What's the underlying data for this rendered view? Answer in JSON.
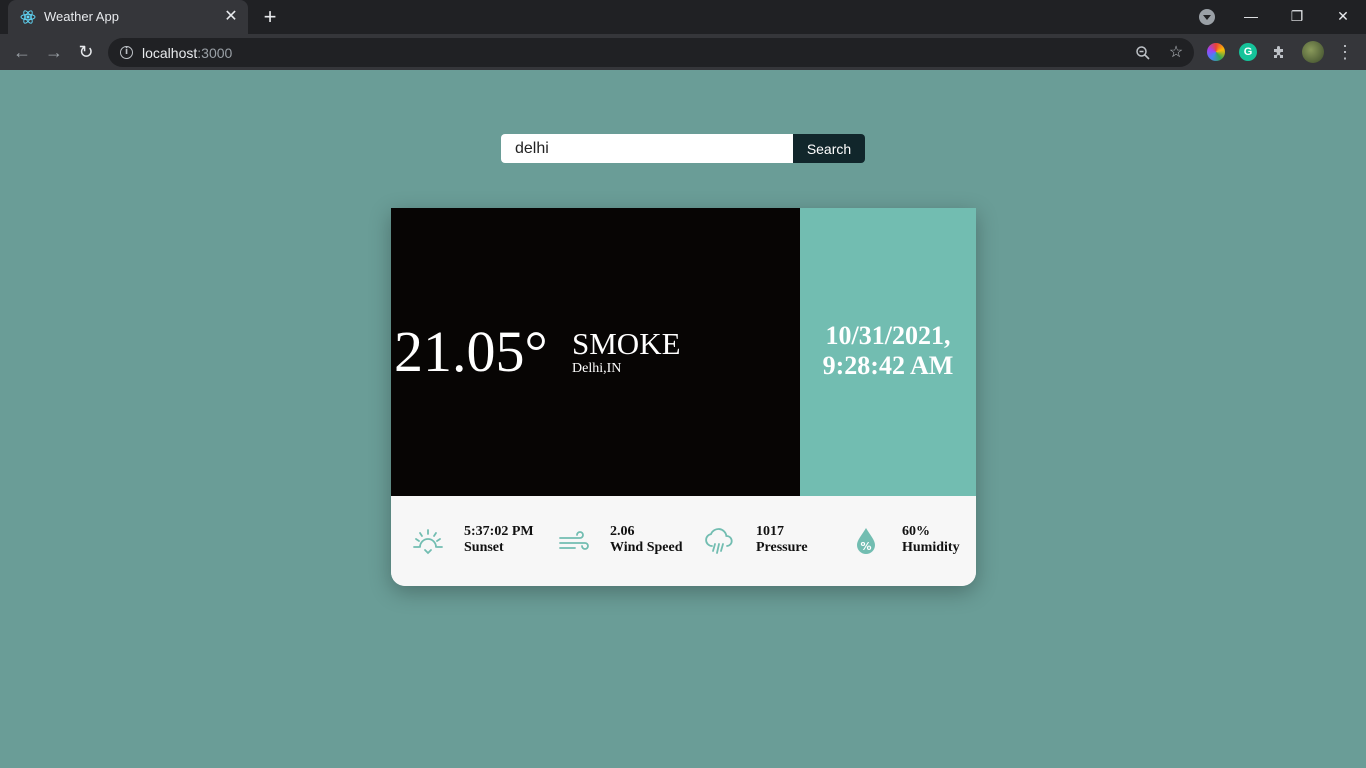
{
  "browser": {
    "tab_title": "Weather App",
    "url_host": "localhost",
    "url_port": ":3000"
  },
  "search": {
    "value": "delhi",
    "button_label": "Search"
  },
  "weather": {
    "temperature": "21.05°",
    "condition": "SMOKE",
    "location": "Delhi,IN",
    "date_line1": "10/31/2021,",
    "date_line2": "9:28:42 AM"
  },
  "stats": [
    {
      "value": "5:37:02 PM",
      "label": "Sunset",
      "icon": "sunset-icon"
    },
    {
      "value": "2.06",
      "label": "Wind Speed",
      "icon": "wind-icon"
    },
    {
      "value": "1017",
      "label": "Pressure",
      "icon": "rain-cloud-icon"
    },
    {
      "value": "60%",
      "label": "Humidity",
      "icon": "humidity-drop-icon"
    }
  ],
  "colors": {
    "page_bg": "#6a9d97",
    "card_dark": "#070504",
    "accent_teal": "#72bdb1",
    "search_button": "#11262b"
  }
}
